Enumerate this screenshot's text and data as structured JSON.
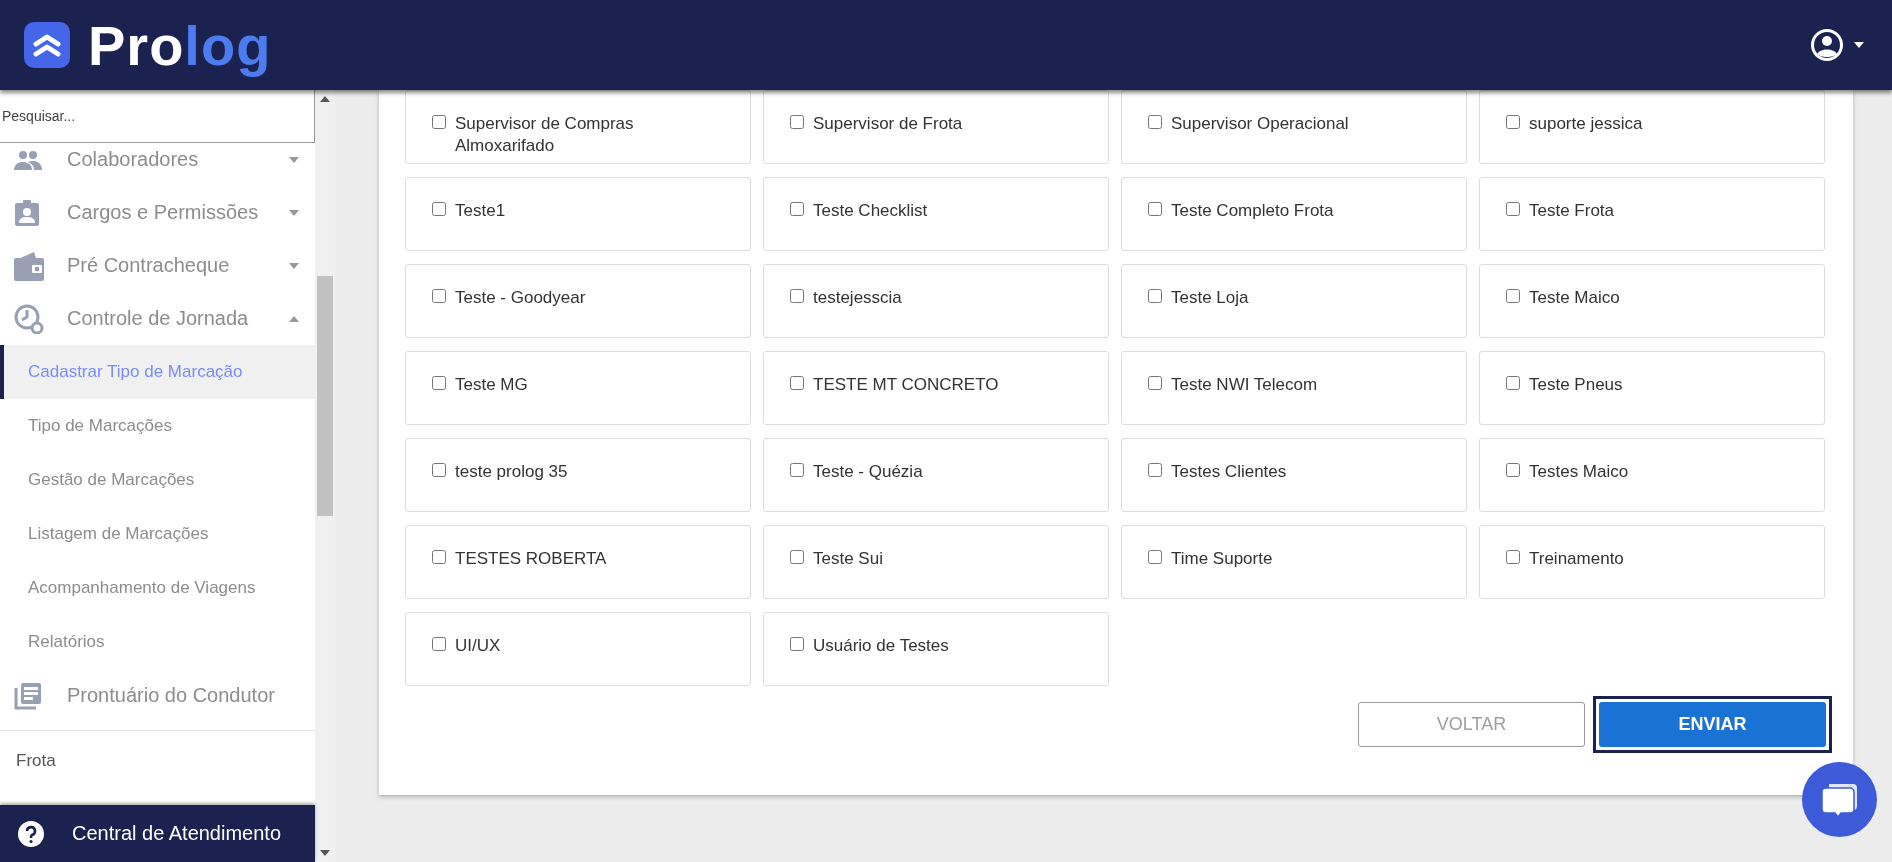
{
  "header": {
    "logo": [
      "Pro",
      "log"
    ]
  },
  "sidebar": {
    "search": {
      "placeholder": "Pesquisar..."
    },
    "groups": [
      {
        "label": "Colaboradores",
        "expanded": false
      },
      {
        "label": "Cargos e Permissões",
        "expanded": false
      },
      {
        "label": "Pré Contracheque",
        "expanded": false
      },
      {
        "label": "Controle de Jornada",
        "expanded": true,
        "children": [
          {
            "label": "Cadastrar Tipo de Marcação",
            "selected": true
          },
          {
            "label": "Tipo de Marcações",
            "selected": false
          },
          {
            "label": "Gestão de Marcações",
            "selected": false
          },
          {
            "label": "Listagem de Marcações",
            "selected": false
          },
          {
            "label": "Acompanhamento de Viagens",
            "selected": false
          },
          {
            "label": "Relatórios",
            "selected": false
          }
        ]
      },
      {
        "label": "Prontuário do Condutor"
      }
    ],
    "section": "Frota",
    "help": "Central de Atendimento"
  },
  "options": [
    {
      "label": "Supervisor de Compras Almoxarifado",
      "checked": false
    },
    {
      "label": "Supervisor de Frota",
      "checked": false
    },
    {
      "label": "Supervisor Operacional",
      "checked": false
    },
    {
      "label": "suporte jessica",
      "checked": false
    },
    {
      "label": "Teste1",
      "checked": false
    },
    {
      "label": "Teste Checklist",
      "checked": false
    },
    {
      "label": "Teste Completo Frota",
      "checked": false
    },
    {
      "label": "Teste Frota",
      "checked": false
    },
    {
      "label": "Teste - Goodyear",
      "checked": false
    },
    {
      "label": "testejesscia",
      "checked": false
    },
    {
      "label": "Teste Loja",
      "checked": false
    },
    {
      "label": "Teste Maico",
      "checked": false
    },
    {
      "label": "Teste MG",
      "checked": false
    },
    {
      "label": "TESTE MT CONCRETO",
      "checked": false
    },
    {
      "label": "Teste NWI Telecom",
      "checked": false
    },
    {
      "label": "Teste Pneus",
      "checked": false
    },
    {
      "label": "teste prolog 35",
      "checked": false
    },
    {
      "label": "Teste - Quézia",
      "checked": false
    },
    {
      "label": "Testes Clientes",
      "checked": false
    },
    {
      "label": "Testes Maico",
      "checked": false
    },
    {
      "label": "TESTES ROBERTA",
      "checked": false
    },
    {
      "label": "Teste Sui",
      "checked": false
    },
    {
      "label": "Time Suporte",
      "checked": false
    },
    {
      "label": "Treinamento",
      "checked": false
    },
    {
      "label": "UI/UX",
      "checked": false
    },
    {
      "label": "Usuário de Testes",
      "checked": false
    }
  ],
  "buttons": {
    "back": "VOLTAR",
    "submit": "ENVIAR"
  }
}
